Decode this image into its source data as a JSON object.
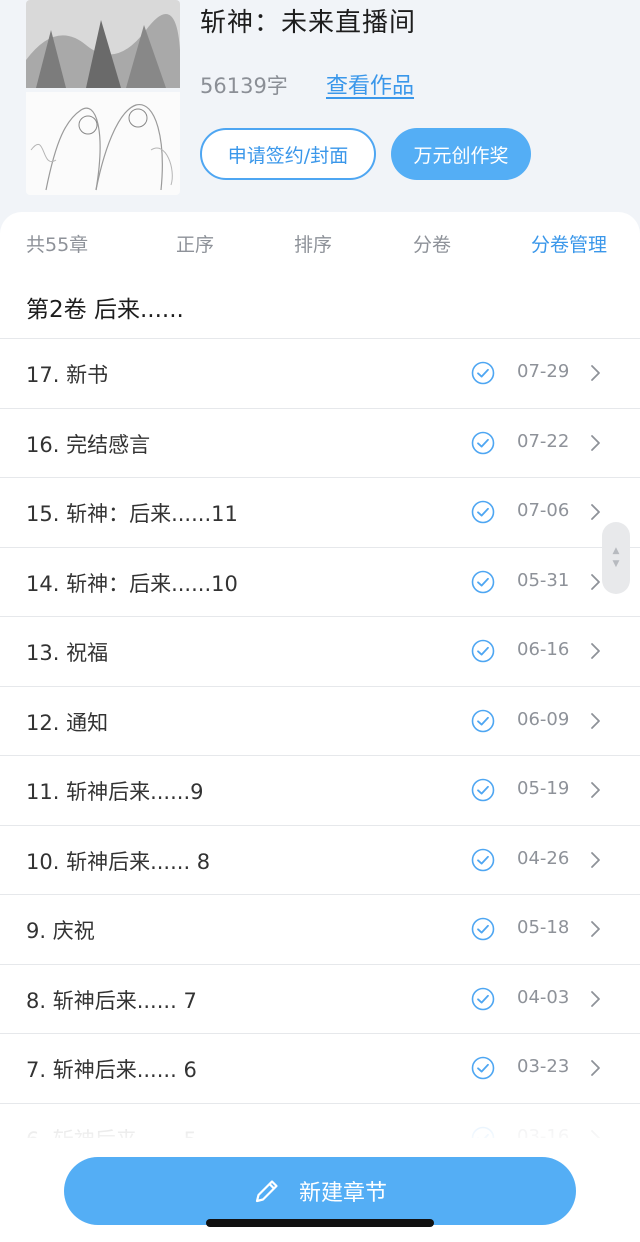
{
  "book": {
    "title": "斩神：未来直播间",
    "word_count": "56139字",
    "view_works_label": "查看作品",
    "apply_sign_label": "申请签约/封面",
    "award_label": "万元创作奖"
  },
  "tabs": {
    "chapter_count": "共55章",
    "order": "正序",
    "sort": "排序",
    "volume": "分卷",
    "volume_manage": "分卷管理"
  },
  "volume_title": "第2卷 后来......",
  "chapters": [
    {
      "title": "17. 新书",
      "date": "07-29"
    },
    {
      "title": "16. 完结感言",
      "date": "07-22"
    },
    {
      "title": "15. 斩神：后来......11",
      "date": "07-06"
    },
    {
      "title": "14. 斩神：后来......10",
      "date": "05-31"
    },
    {
      "title": "13. 祝福",
      "date": "06-16"
    },
    {
      "title": "12. 通知",
      "date": "06-09"
    },
    {
      "title": "11. 斩神后来......9",
      "date": "05-19"
    },
    {
      "title": "10. 斩神后来...... 8",
      "date": "04-26"
    },
    {
      "title": "9. 庆祝",
      "date": "05-18"
    },
    {
      "title": "8. 斩神后来...... 7",
      "date": "04-03"
    },
    {
      "title": "7. 斩神后来...... 6",
      "date": "03-23"
    },
    {
      "title": "6. 斩神后来...... 5",
      "date": "03-16"
    }
  ],
  "new_chapter_label": "新建章节",
  "colors": {
    "accent": "#3a97ea",
    "button_fill": "#54aef5",
    "header_bg": "#f1f4f8"
  },
  "icons": {
    "status": "check-circle-icon",
    "row_arrow": "chevron-right-icon",
    "new_chapter": "pencil-icon",
    "scroll": "scroll-handle-icon"
  }
}
